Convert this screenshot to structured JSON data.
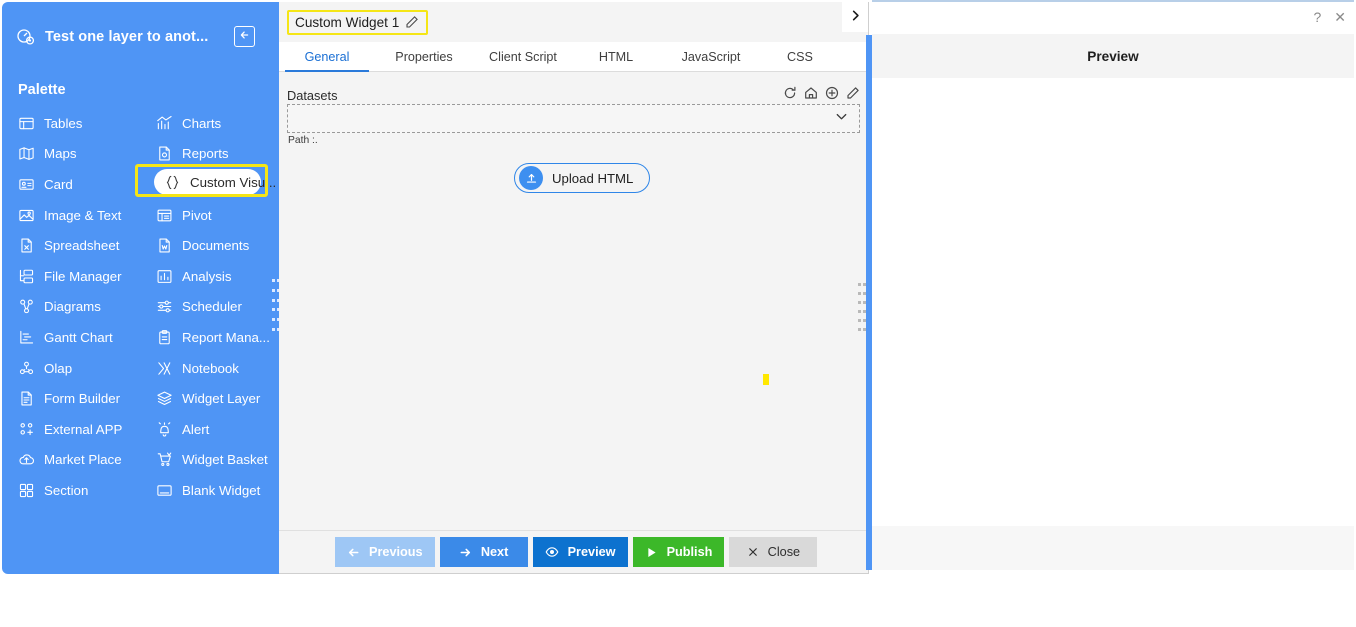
{
  "sidebar": {
    "header_icon": "dashboard-gauge-icon",
    "title": "Test one layer to anot...",
    "collapse_icon": "arrow-left-square-icon",
    "section_label": "Palette",
    "items": [
      {
        "label": "Tables",
        "icon": "table-icon",
        "col": "left",
        "selected": false
      },
      {
        "label": "Charts",
        "icon": "chart-icon",
        "col": "right",
        "selected": false
      },
      {
        "label": "Maps",
        "icon": "map-icon",
        "col": "left",
        "selected": false
      },
      {
        "label": "Reports",
        "icon": "report-icon",
        "col": "right",
        "selected": false
      },
      {
        "label": "Card",
        "icon": "card-icon",
        "col": "left",
        "selected": false
      },
      {
        "label": "Custom Visu...",
        "icon": "braces-icon",
        "col": "right",
        "selected": true
      },
      {
        "label": "Image & Text",
        "icon": "image-text-icon",
        "col": "left",
        "selected": false
      },
      {
        "label": "Pivot",
        "icon": "pivot-icon",
        "col": "right",
        "selected": false
      },
      {
        "label": "Spreadsheet",
        "icon": "spreadsheet-icon",
        "col": "left",
        "selected": false
      },
      {
        "label": "Documents",
        "icon": "document-icon",
        "col": "right",
        "selected": false
      },
      {
        "label": "File Manager",
        "icon": "file-manager-icon",
        "col": "left",
        "selected": false
      },
      {
        "label": "Analysis",
        "icon": "analysis-icon",
        "col": "right",
        "selected": false
      },
      {
        "label": "Diagrams",
        "icon": "diagram-icon",
        "col": "left",
        "selected": false
      },
      {
        "label": "Scheduler",
        "icon": "scheduler-icon",
        "col": "right",
        "selected": false
      },
      {
        "label": "Gantt Chart",
        "icon": "gantt-icon",
        "col": "left",
        "selected": false
      },
      {
        "label": "Report Mana...",
        "icon": "clipboard-icon",
        "col": "right",
        "selected": false
      },
      {
        "label": "Olap",
        "icon": "olap-icon",
        "col": "left",
        "selected": false
      },
      {
        "label": "Notebook",
        "icon": "notebook-icon",
        "col": "right",
        "selected": false
      },
      {
        "label": "Form Builder",
        "icon": "form-icon",
        "col": "left",
        "selected": false
      },
      {
        "label": "Widget Layer",
        "icon": "layers-icon",
        "col": "right",
        "selected": false
      },
      {
        "label": "External APP",
        "icon": "external-app-icon",
        "col": "left",
        "selected": false
      },
      {
        "label": "Alert",
        "icon": "bell-alert-icon",
        "col": "right",
        "selected": false
      },
      {
        "label": "Market Place",
        "icon": "cloud-up-icon",
        "col": "left",
        "selected": false
      },
      {
        "label": "Widget Basket",
        "icon": "cart-icon",
        "col": "right",
        "selected": false
      },
      {
        "label": "Section",
        "icon": "grid-section-icon",
        "col": "left",
        "selected": false
      },
      {
        "label": "Blank Widget",
        "icon": "blank-widget-icon",
        "col": "right",
        "selected": false
      }
    ]
  },
  "editor": {
    "widget_title": "Custom Widget 1",
    "widget_title_edit_icon": "pencil-edit-icon",
    "tabs": [
      {
        "label": "General",
        "active": true
      },
      {
        "label": "Properties",
        "active": false
      },
      {
        "label": "Client Script",
        "active": false
      },
      {
        "label": "HTML",
        "active": false
      },
      {
        "label": "JavaScript",
        "active": false
      },
      {
        "label": "CSS",
        "active": false
      }
    ],
    "tabs_more_icon": "chevron-right-icon",
    "datasets": {
      "label": "Datasets",
      "tools": [
        {
          "icon": "refresh-icon"
        },
        {
          "icon": "home-icon"
        },
        {
          "icon": "add-circle-icon"
        },
        {
          "icon": "pencil-edit-icon"
        }
      ],
      "selected_value": "",
      "placeholder": "",
      "dropdown_icon": "chevron-down-icon",
      "path_text": "Path :."
    },
    "upload": {
      "label": "Upload HTML",
      "icon": "upload-icon"
    },
    "actions": [
      {
        "label": "Previous",
        "icon": "arrow-left-icon",
        "style": "prev"
      },
      {
        "label": "Next",
        "icon": "arrow-right-icon",
        "style": "next"
      },
      {
        "label": "Preview",
        "icon": "eye-icon",
        "style": "preview"
      },
      {
        "label": "Publish",
        "icon": "play-icon",
        "style": "publish"
      },
      {
        "label": "Close",
        "icon": "close-x-icon",
        "style": "close"
      }
    ]
  },
  "preview": {
    "title": "Preview",
    "help_glyph": "?",
    "close_glyph": "✕"
  },
  "colors": {
    "sidebar_blue": "#4f95f5",
    "highlight_yellow": "#f5e616",
    "tab_active_blue": "#2a7ada",
    "publish_green": "#3cb829",
    "preview_blue": "#0d72cf",
    "next_blue": "#3b8ae8",
    "prev_blue": "#9ec7f5"
  }
}
